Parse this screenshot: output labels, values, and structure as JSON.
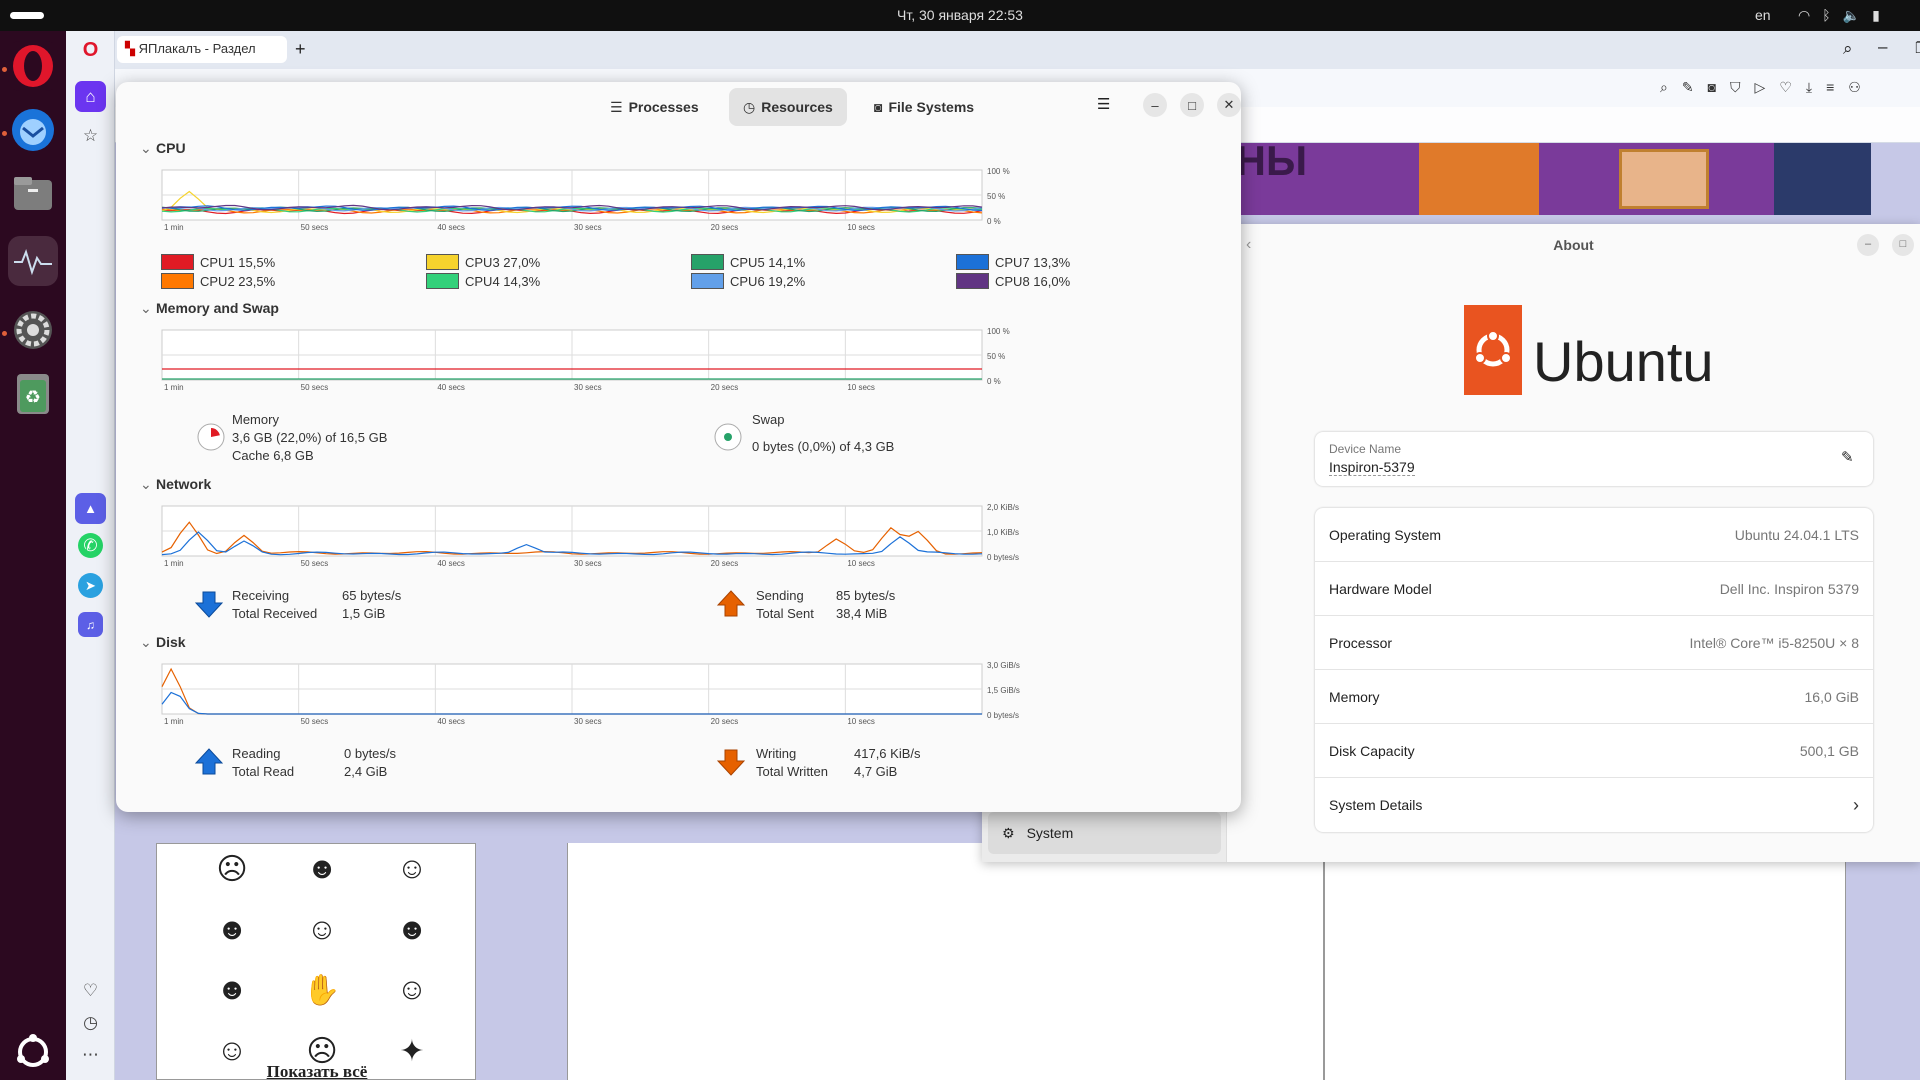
{
  "topbar": {
    "datetime": "Чт, 30 января  22:53",
    "lang": "en"
  },
  "dock": {
    "items": [
      "Opera",
      "Thunderbird",
      "Files",
      "System Monitor",
      "Settings",
      "Trash",
      "Show Apps"
    ]
  },
  "browser": {
    "tab_title": "ЯПлакалъ - Раздел",
    "new_tab": "+",
    "banner_text": "ОНЫ",
    "show_all": "Показать всё"
  },
  "sysmon": {
    "tabs": [
      "Processes",
      "Resources",
      "File Systems"
    ],
    "sections": {
      "cpu": "CPU",
      "memory": "Memory and Swap",
      "network": "Network",
      "disk": "Disk"
    },
    "time_ticks": [
      "1 min",
      "50 secs",
      "40 secs",
      "30 secs",
      "20 secs",
      "10 secs"
    ],
    "pct_ticks": [
      "100 %",
      "50 %",
      "0 %"
    ],
    "net_ticks": [
      "2,0 KiB/s",
      "1,0 KiB/s",
      "0 bytes/s"
    ],
    "disk_ticks": [
      "3,0 GiB/s",
      "1,5 GiB/s",
      "0 bytes/s"
    ],
    "cpus": [
      {
        "label": "CPU1",
        "value": "15,5%",
        "color": "#e01b24"
      },
      {
        "label": "CPU2",
        "value": "23,5%",
        "color": "#ff7800"
      },
      {
        "label": "CPU3",
        "value": "27,0%",
        "color": "#f6d32d"
      },
      {
        "label": "CPU4",
        "value": "14,3%",
        "color": "#33d17a"
      },
      {
        "label": "CPU5",
        "value": "14,1%",
        "color": "#26a269"
      },
      {
        "label": "CPU6",
        "value": "19,2%",
        "color": "#62a0ea"
      },
      {
        "label": "CPU7",
        "value": "13,3%",
        "color": "#1c71d8"
      },
      {
        "label": "CPU8",
        "value": "16,0%",
        "color": "#613583"
      }
    ],
    "memory": {
      "title": "Memory",
      "usage": "3,6 GB (22,0%) of 16,5 GB",
      "cache": "Cache 6,8 GB",
      "fraction": 0.22
    },
    "swap": {
      "title": "Swap",
      "usage": "0 bytes (0,0%) of 4,3 GB",
      "fraction": 0.0
    },
    "network": {
      "receiving_label": "Receiving",
      "receiving_value": "65 bytes/s",
      "total_received_label": "Total Received",
      "total_received_value": "1,5 GiB",
      "sending_label": "Sending",
      "sending_value": "85 bytes/s",
      "total_sent_label": "Total Sent",
      "total_sent_value": "38,4 MiB"
    },
    "disk": {
      "reading_label": "Reading",
      "reading_value": "0 bytes/s",
      "total_read_label": "Total Read",
      "total_read_value": "2,4 GiB",
      "writing_label": "Writing",
      "writing_value": "417,6 KiB/s",
      "total_written_label": "Total Written",
      "total_written_value": "4,7 GiB"
    }
  },
  "about": {
    "title": "About",
    "logo_text": "Ubuntu",
    "device_name_label": "Device Name",
    "device_name": "Inspiron-5379",
    "rows": [
      {
        "key": "Operating System",
        "value": "Ubuntu 24.04.1 LTS"
      },
      {
        "key": "Hardware Model",
        "value": "Dell Inc. Inspiron 5379"
      },
      {
        "key": "Processor",
        "value": "Intel® Core™ i5-8250U × 8"
      },
      {
        "key": "Memory",
        "value": "16,0 GiB"
      },
      {
        "key": "Disk Capacity",
        "value": "500,1 GB"
      },
      {
        "key": "System Details",
        "value": "›"
      }
    ],
    "sidebar_item": "System"
  },
  "colors": {
    "accent": "#e95420",
    "dock_bg": "#2c0920",
    "recv": "#1c71d8",
    "send": "#e66100"
  }
}
